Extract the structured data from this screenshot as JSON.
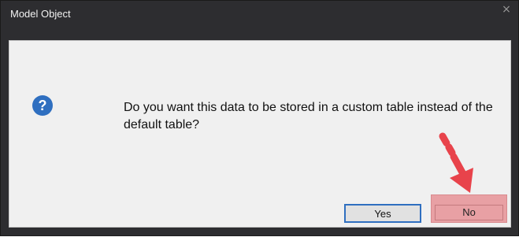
{
  "window": {
    "title": "Model Object",
    "close_glyph": "×"
  },
  "dialog": {
    "icon": "question-icon",
    "message": "Do you want this data to be stored in a custom table instead of the default table?"
  },
  "buttons": {
    "yes_label": "Yes",
    "no_label": "No"
  },
  "colors": {
    "titlebar": "#2d2d30",
    "panel": "#f0f0f0",
    "icon_blue": "#2f6fc0",
    "annotation_red": "#e8434b",
    "no_highlight": "#e8a0a4"
  }
}
